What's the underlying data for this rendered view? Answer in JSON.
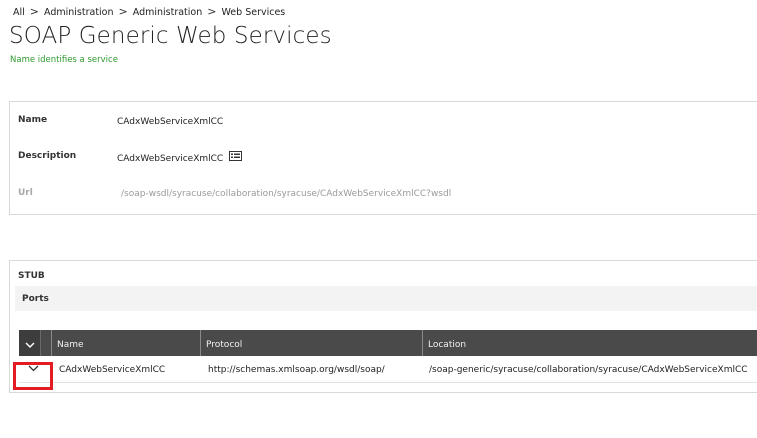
{
  "breadcrumb": {
    "items": [
      "All",
      "Administration",
      "Administration",
      "Web Services"
    ],
    "separator": ">"
  },
  "header": {
    "title": "SOAP Generic Web Services",
    "subtitle": "Name identifies a service"
  },
  "details": {
    "name_label": "Name",
    "name_value": "CAdxWebServiceXmlCC",
    "description_label": "Description",
    "description_value": "CAdxWebServiceXmlCC",
    "url_label": "Url",
    "url_value": "/soap-wsdl/syracuse/collaboration/syracuse/CAdxWebServiceXmlCC?wsdl"
  },
  "stub": {
    "section_label": "STUB",
    "ports_label": "Ports",
    "table": {
      "expand_icon": "chevron-down-icon",
      "columns": [
        "Name",
        "Protocol",
        "Location"
      ],
      "rows": [
        {
          "name": "CAdxWebServiceXmlCC",
          "protocol": "http://schemas.xmlsoap.org/wsdl/soap/",
          "location": "/soap-generic/syracuse/collaboration/syracuse/CAdxWebServiceXmlCC"
        }
      ]
    }
  },
  "colors": {
    "subtitle_green": "#2d9a2d",
    "table_header_bg": "#4a4a4a",
    "highlight_red": "#e31b23"
  }
}
